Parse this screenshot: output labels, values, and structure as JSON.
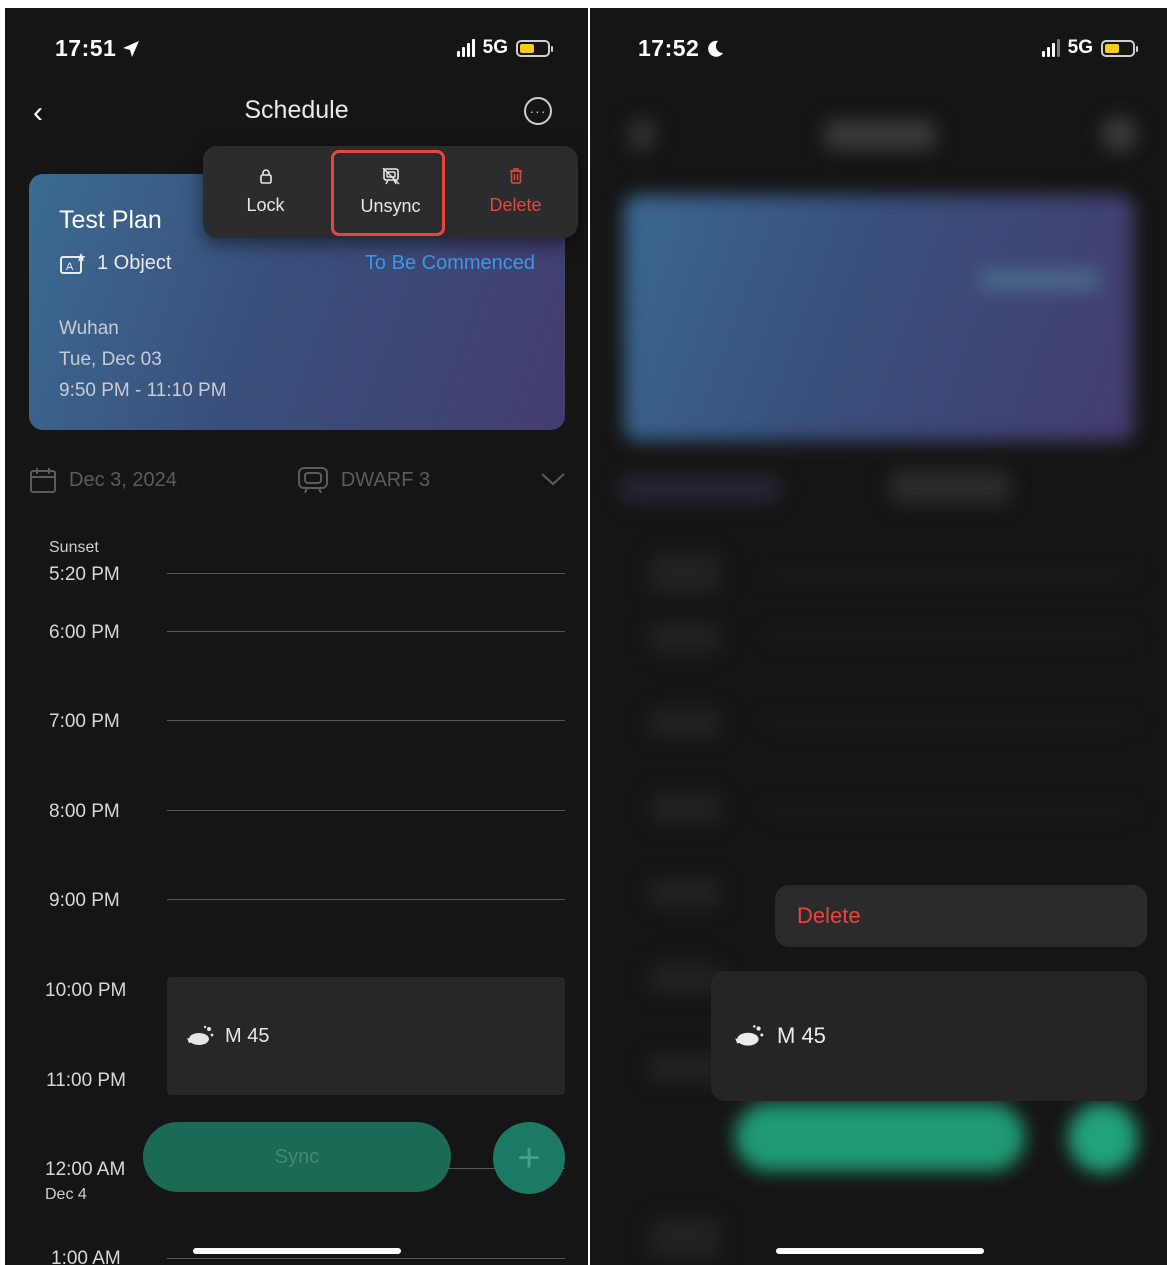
{
  "left": {
    "status": {
      "time": "17:51",
      "network": "5G"
    },
    "header": {
      "title": "Schedule"
    },
    "plan": {
      "title": "Test Plan",
      "objects": "1 Object",
      "status": "To Be Commenced",
      "location": "Wuhan",
      "date": "Tue, Dec 03",
      "time_range": "9:50 PM - 11:10 PM"
    },
    "menu": {
      "lock": "Lock",
      "unsync": "Unsync",
      "delete": "Delete"
    },
    "filter": {
      "date": "Dec 3, 2024",
      "device": "DWARF 3"
    },
    "timeline": {
      "sunset_label": "Sunset",
      "labels": [
        "5:20 PM",
        "6:00 PM",
        "7:00 PM",
        "8:00 PM",
        "9:00 PM",
        "10:00 PM",
        "11:00 PM",
        "12:00 AM",
        "1:00 AM"
      ],
      "next_day": "Dec 4"
    },
    "event": {
      "target": "M 45"
    },
    "actions": {
      "sync": "Sync",
      "add": "+"
    }
  },
  "right": {
    "status": {
      "time": "17:52",
      "network": "5G"
    },
    "menu": {
      "delete": "Delete"
    },
    "event": {
      "target": "M 45"
    }
  },
  "colors": {
    "accent_blue": "#3d9ae6",
    "danger_red": "#e8453c",
    "sync_green": "#1b6a55",
    "battery_yellow": "#f5cc1b"
  },
  "icons": [
    "location-arrow-icon",
    "moon-icon",
    "signal-icon",
    "battery-icon",
    "back-chevron-icon",
    "more-icon",
    "lock-icon",
    "unsync-icon",
    "trash-icon",
    "object-icon",
    "calendar-icon",
    "telescope-icon",
    "chevron-down-icon",
    "nebula-icon",
    "plus-icon"
  ]
}
